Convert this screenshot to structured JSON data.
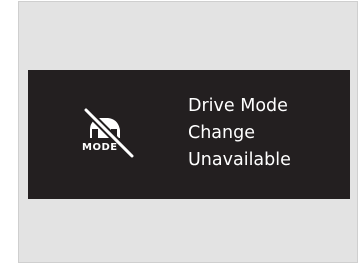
{
  "notification": {
    "icon_name": "drive-mode-unavailable-icon",
    "icon_text": "MODE",
    "lines": [
      "Drive Mode",
      "Change",
      "Unavailable"
    ]
  },
  "colors": {
    "outer_background": "#e3e3e3",
    "banner_background": "#231f20",
    "text": "#ffffff"
  }
}
